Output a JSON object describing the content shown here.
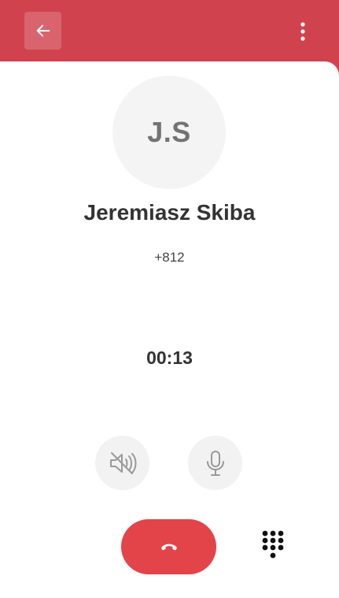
{
  "contact": {
    "initials": "J.S",
    "name": "Jeremiasz Skiba",
    "number": "+812"
  },
  "call": {
    "timer": "00:13"
  },
  "icons": {
    "back": "arrow-left-icon",
    "more": "more-vertical-icon",
    "speaker": "speaker-muted-icon",
    "mic": "microphone-icon",
    "hangup": "phone-hangup-icon",
    "dialpad": "dialpad-icon"
  },
  "colors": {
    "header": "#d1424f",
    "hangup": "#e3444a",
    "button_bg": "#f2f2f2",
    "avatar_bg": "#f4f4f4",
    "text": "#333333"
  }
}
